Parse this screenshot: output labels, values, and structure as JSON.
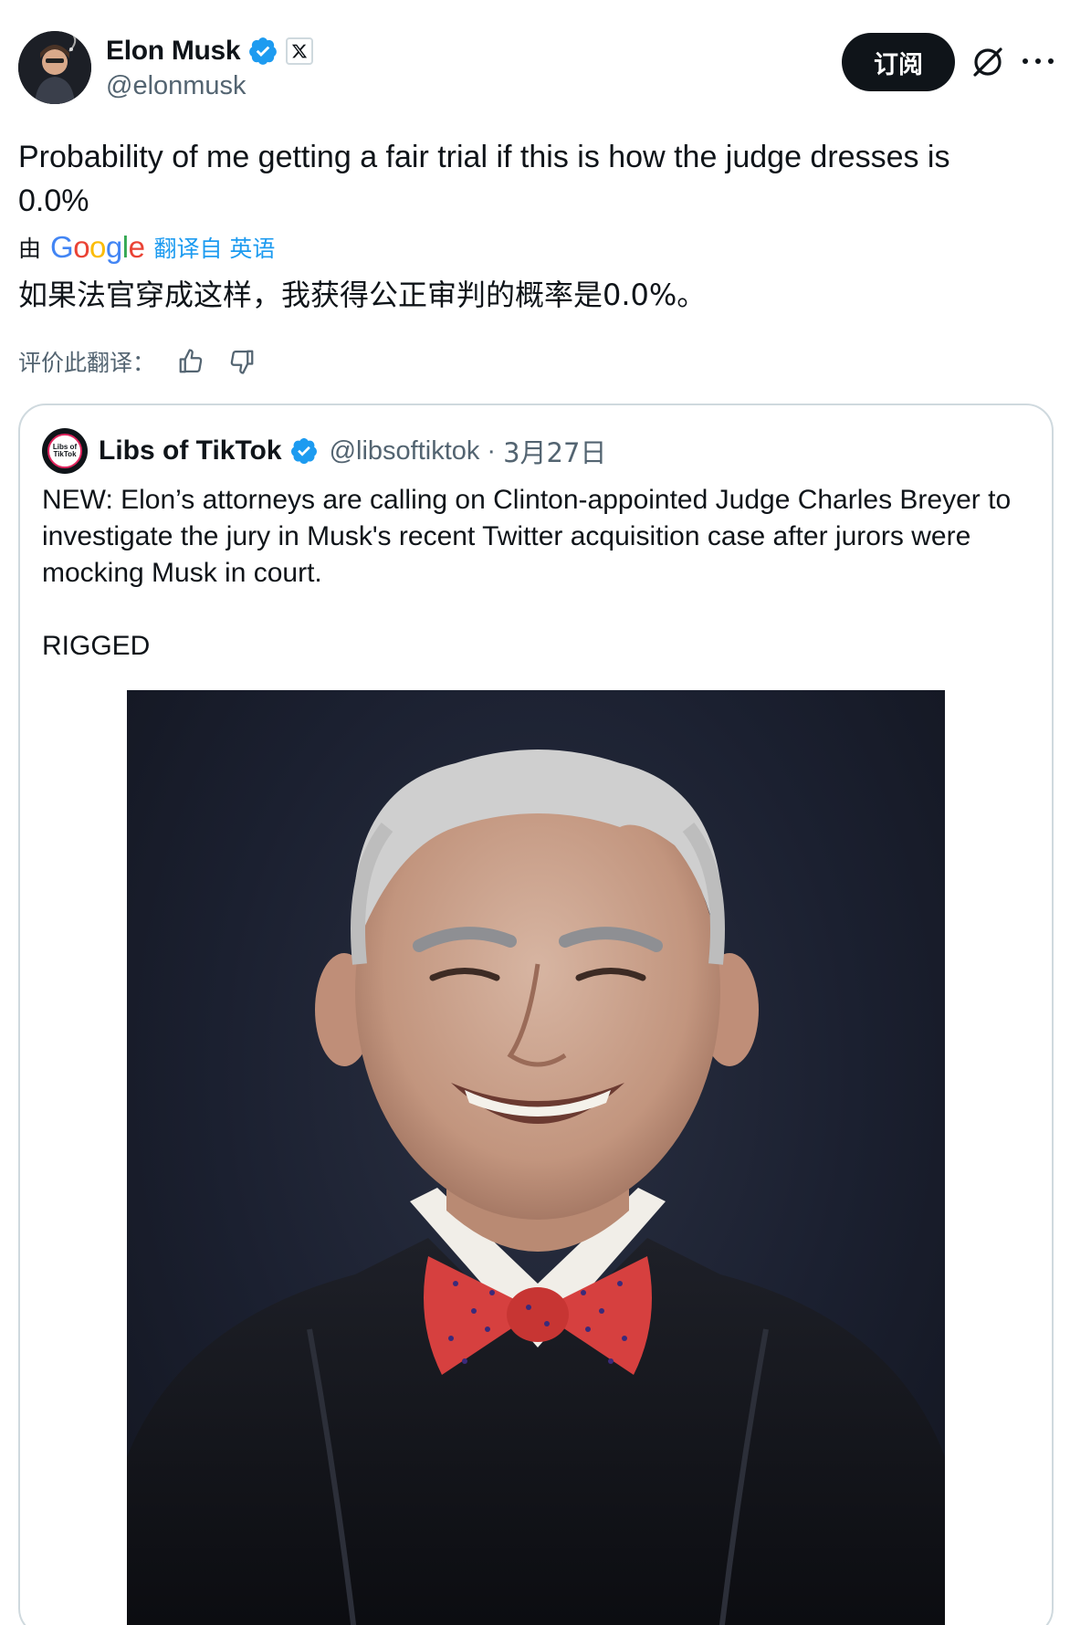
{
  "tweet": {
    "author": {
      "display_name": "Elon Musk",
      "handle": "@elonmusk",
      "verified": true,
      "affiliate_badge": "x-logo-icon"
    },
    "subscribe_label": "订阅",
    "text_line1": "Probability of me getting a fair trial if this is how the judge dresses is",
    "text_line2": "0.0%",
    "translation": {
      "by_label": "由",
      "provider": "Google",
      "link_label": "翻译自 英语",
      "translated_text": "如果法官穿成这样，我获得公正审判的概率是0.0%。",
      "rate_label": "评价此翻译："
    }
  },
  "quoted_tweet": {
    "author": {
      "display_name": "Libs of TikTok",
      "handle": "@libsoftiktok",
      "avatar_text": "Libs of TikTok",
      "verified": true
    },
    "separator": "·",
    "date": "3月27日",
    "text_para1": "NEW: Elon’s attorneys are calling on Clinton-appointed Judge Charles Breyer to investigate the jury in Musk's recent Twitter acquisition case after jurors were mocking Musk in court.",
    "text_para2": "RIGGED"
  },
  "colors": {
    "text_primary": "#0f1419",
    "text_secondary": "#536471",
    "link": "#1d9bf0",
    "verified": "#1d9bf0",
    "border": "#cfd9de",
    "subscribe_bg": "#0f1419"
  }
}
